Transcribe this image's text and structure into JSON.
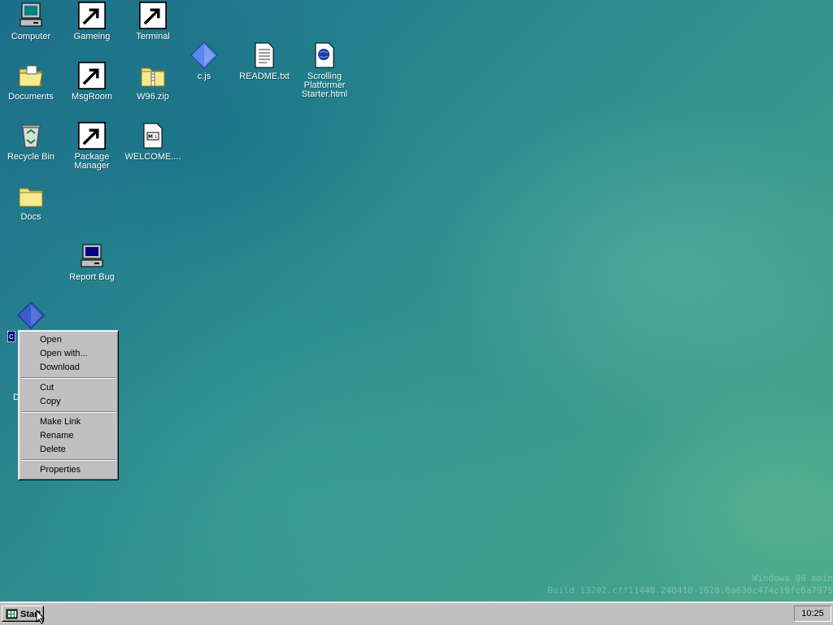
{
  "desktop": {
    "icons": {
      "computer": "Computer",
      "gameing": "Gameing",
      "terminal": "Terminal",
      "documents": "Documents",
      "msgroom": "MsgRoom",
      "w96zip": "W96.zip",
      "cjs_top": "c.js",
      "readme": "README.txt",
      "scrolling": "Scrolling Platformer Starter.html",
      "recycle": "Recycle Bin",
      "package_manager": "Package Manager",
      "welcome": "WELCOME....",
      "docs": "Docs",
      "report_bug": "Report Bug",
      "cjs_selected": "c.js"
    },
    "partial_label": "D",
    "watermark": {
      "line1": "Windows 96 main",
      "line2": "Build 13202.cff11448.240410-1628.0a630c474c19fc6a7975"
    }
  },
  "context_menu": {
    "items": [
      "Open",
      "Open with...",
      "Download",
      "Cut",
      "Copy",
      "Make Link",
      "Rename",
      "Delete",
      "Properties"
    ]
  },
  "taskbar": {
    "start_label": "Start",
    "clock": "10:25"
  }
}
